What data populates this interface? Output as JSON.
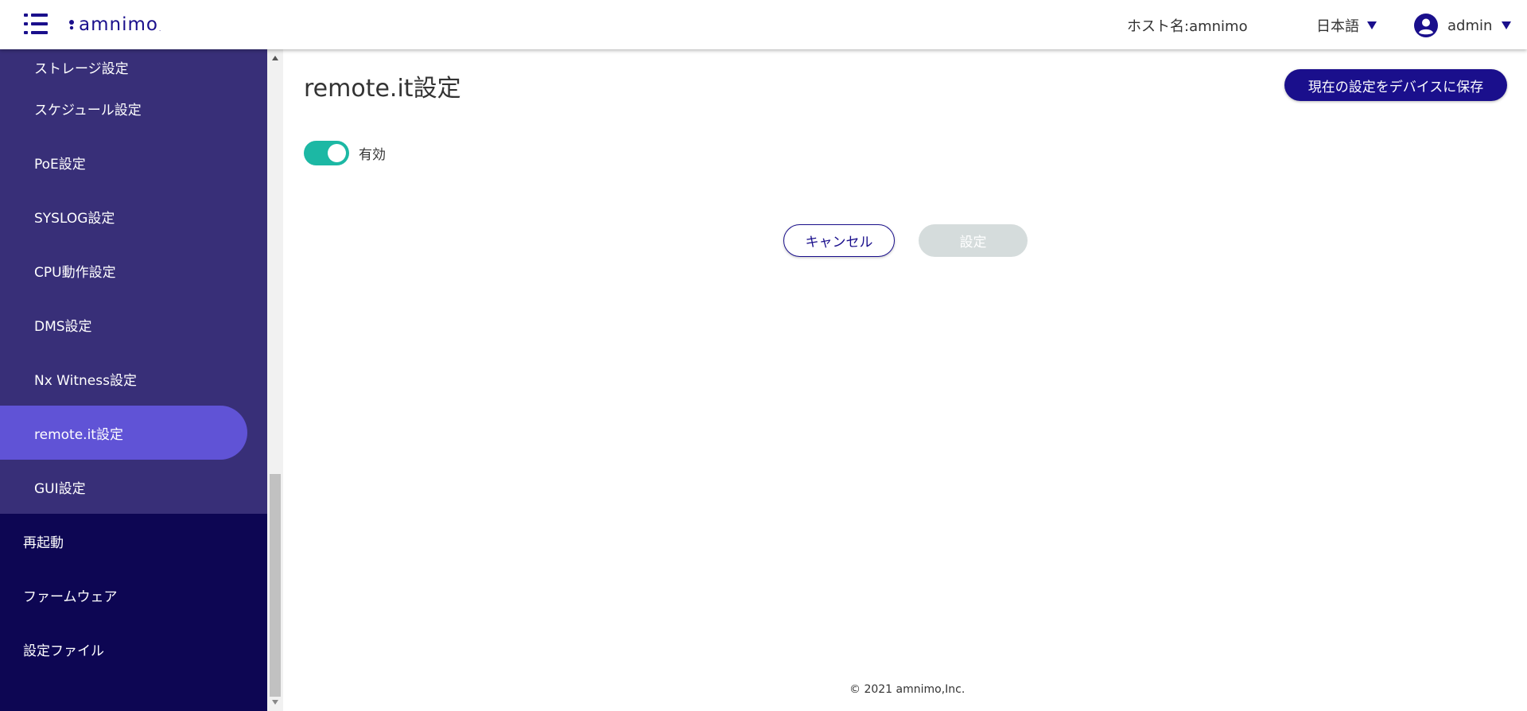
{
  "header": {
    "menu_icon": "list-menu-icon",
    "logo_text": "amnimo",
    "logo_mark": ".",
    "host_label": "ホスト名:amnimo",
    "language": "日本語",
    "user": "admin",
    "user_icon": "account-circle-icon",
    "brand_color": "#1a0f8c"
  },
  "sidebar": {
    "sub_items": [
      {
        "label": "ストレージ設定"
      },
      {
        "label": "スケジュール設定"
      },
      {
        "label": "PoE設定"
      },
      {
        "label": "SYSLOG設定"
      },
      {
        "label": "CPU動作設定"
      },
      {
        "label": "DMS設定"
      },
      {
        "label": "Nx Witness設定"
      },
      {
        "label": "remote.it設定",
        "active": true
      },
      {
        "label": "GUI設定"
      }
    ],
    "top_items": [
      {
        "label": "再起動"
      },
      {
        "label": "ファームウェア"
      },
      {
        "label": "設定ファイル"
      }
    ],
    "colors": {
      "background": "#0d0653",
      "submenu": "#382f78",
      "active": "#6053d6"
    }
  },
  "main": {
    "title": "remote.it設定",
    "save_to_device_label": "現在の設定をデバイスに保存",
    "toggle": {
      "label": "有効",
      "on": true,
      "color": "#1cb8a4"
    },
    "cancel_label": "キャンセル",
    "apply_label": "設定",
    "apply_disabled": true
  },
  "footer": {
    "copyright": "© 2021 amnimo,Inc."
  }
}
